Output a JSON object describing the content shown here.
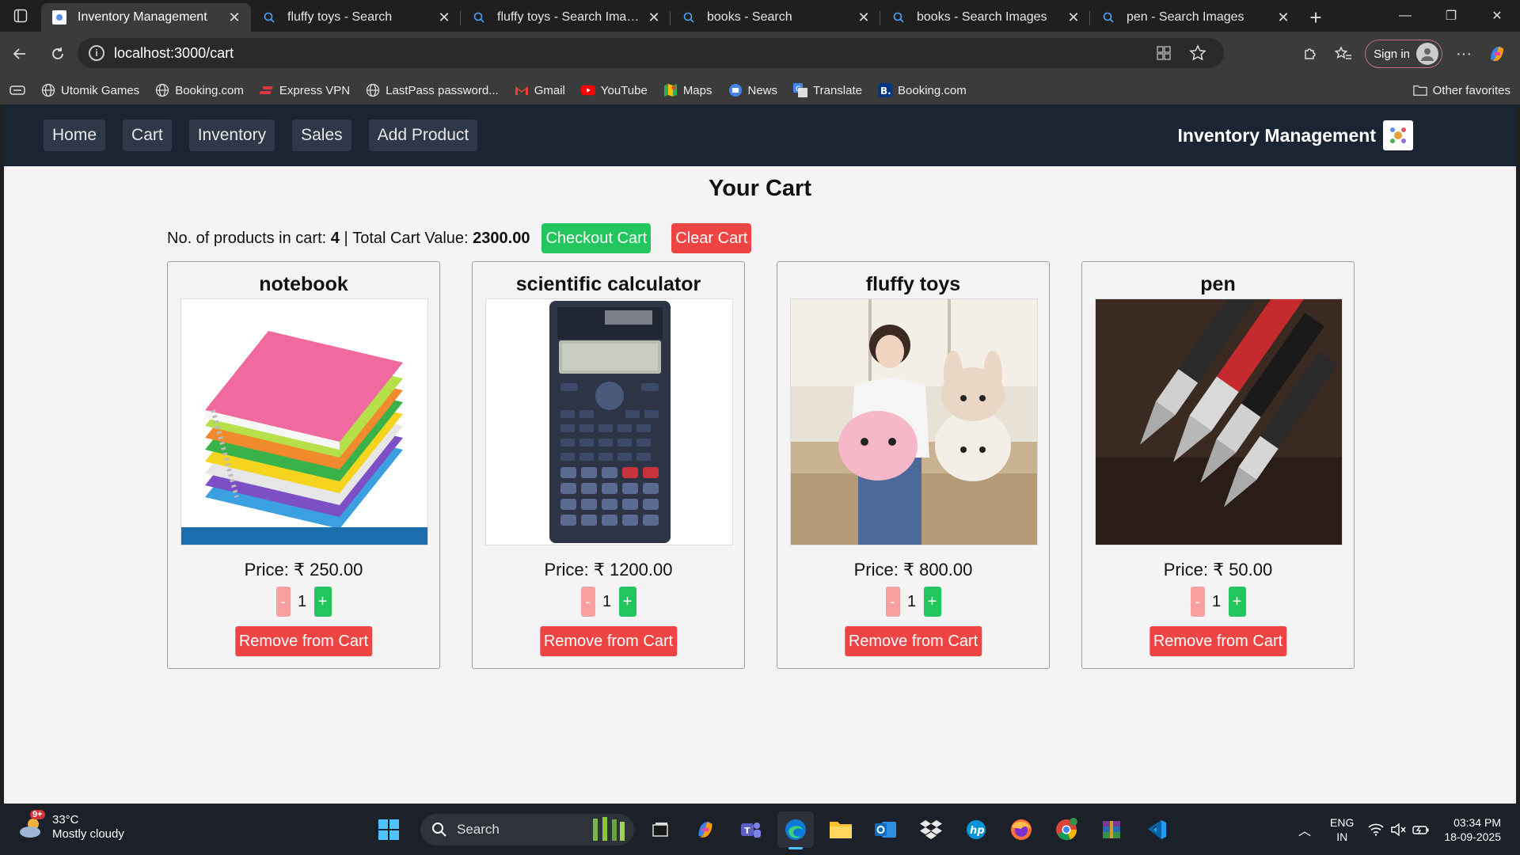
{
  "browser": {
    "tabs": [
      {
        "title": "Inventory Management",
        "active": true,
        "icon": "app-favicon"
      },
      {
        "title": "fluffy toys - Search",
        "active": false,
        "icon": "search-icon"
      },
      {
        "title": "fluffy toys - Search Images",
        "active": false,
        "icon": "search-icon"
      },
      {
        "title": "books - Search",
        "active": false,
        "icon": "search-icon"
      },
      {
        "title": "books - Search Images",
        "active": false,
        "icon": "search-icon"
      },
      {
        "title": "pen - Search Images",
        "active": false,
        "icon": "search-icon"
      }
    ],
    "url": "localhost:3000/cart",
    "signin_label": "Sign in",
    "favorites": [
      {
        "label": "Utomik Games",
        "icon": "globe-icon"
      },
      {
        "label": "Booking.com",
        "icon": "globe-icon"
      },
      {
        "label": "Express VPN",
        "icon": "vpn-icon"
      },
      {
        "label": "LastPass password...",
        "icon": "globe-icon"
      },
      {
        "label": "Gmail",
        "icon": "gmail-icon"
      },
      {
        "label": "YouTube",
        "icon": "youtube-icon"
      },
      {
        "label": "Maps",
        "icon": "maps-icon"
      },
      {
        "label": "News",
        "icon": "news-icon"
      },
      {
        "label": "Translate",
        "icon": "translate-icon"
      },
      {
        "label": "Booking.com",
        "icon": "booking-icon"
      }
    ],
    "other_favorites": "Other favorites"
  },
  "app": {
    "nav": [
      "Home",
      "Cart",
      "Inventory",
      "Sales",
      "Add Product"
    ],
    "brand": "Inventory Management",
    "cart_title": "Your Cart",
    "summary": {
      "products_label": "No. of products in cart:",
      "products_count": "4",
      "separator": "|",
      "total_label": "Total Cart Value:",
      "total_value": "2300.00"
    },
    "checkout_label": "Checkout Cart",
    "clear_label": "Clear Cart",
    "products": [
      {
        "name": "notebook",
        "price": "Price: ₹ 250.00",
        "qty": "1",
        "image": "notebook-photo"
      },
      {
        "name": "scientific calculator",
        "price": "Price: ₹ 1200.00",
        "qty": "1",
        "image": "calculator-photo"
      },
      {
        "name": "fluffy toys",
        "price": "Price: ₹ 800.00",
        "qty": "1",
        "image": "plush-toys-photo"
      },
      {
        "name": "pen",
        "price": "Price: ₹ 50.00",
        "qty": "1",
        "image": "fountain-pens-photo"
      }
    ],
    "minus_label": "-",
    "plus_label": "+",
    "remove_label": "Remove from Cart"
  },
  "taskbar": {
    "weather_temp": "33°C",
    "weather_desc": "Mostly cloudy",
    "weather_badge": "9+",
    "search_placeholder": "Search",
    "lang_line1": "ENG",
    "lang_line2": "IN",
    "time": "03:34 PM",
    "date": "18-09-2025"
  },
  "colors": {
    "nav_bg": "#1b2432",
    "green": "#22c55e",
    "red": "#ef4444",
    "page_bg": "#f4f4f4"
  }
}
